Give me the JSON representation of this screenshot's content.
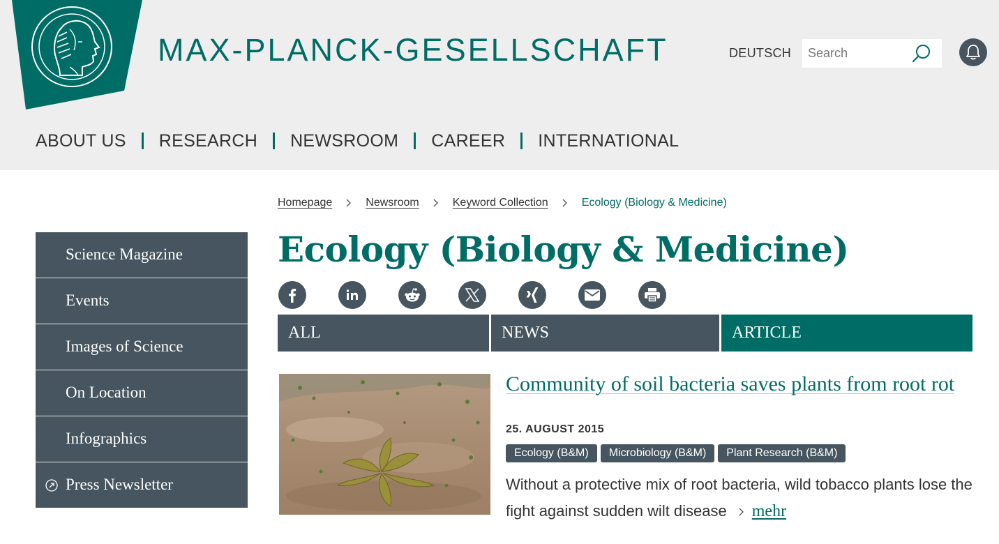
{
  "header": {
    "site_title": "MAX-PLANCK-GESELLSCHAFT",
    "language_link": "DEUTSCH",
    "search_placeholder": "Search"
  },
  "nav": {
    "items": [
      {
        "label": "ABOUT US"
      },
      {
        "label": "RESEARCH"
      },
      {
        "label": "NEWSROOM"
      },
      {
        "label": "CAREER"
      },
      {
        "label": "INTERNATIONAL"
      }
    ]
  },
  "breadcrumb": {
    "items": [
      "Homepage",
      "Newsroom",
      "Keyword Collection"
    ],
    "current": "Ecology (Biology & Medicine)"
  },
  "sidebar": {
    "items": [
      {
        "label": "Science Magazine"
      },
      {
        "label": "Events"
      },
      {
        "label": "Images of Science"
      },
      {
        "label": "On Location"
      },
      {
        "label": "Infographics"
      },
      {
        "label": "Press Newsletter",
        "icon": "external-link-icon"
      }
    ]
  },
  "page": {
    "title": "Ecology (Biology & Medicine)"
  },
  "share_icons": [
    "facebook-icon",
    "linkedin-icon",
    "reddit-icon",
    "x-icon",
    "xing-icon",
    "email-icon",
    "print-icon"
  ],
  "tabs": [
    {
      "label": "ALL",
      "active": false
    },
    {
      "label": "NEWS",
      "active": false
    },
    {
      "label": "ARTICLE",
      "active": true
    }
  ],
  "article": {
    "title": "Community of soil bacteria saves plants from root rot",
    "date": "25. AUGUST 2015",
    "tags": [
      "Ecology (B&M)",
      "Microbiology (B&M)",
      "Plant Research (B&M)"
    ],
    "teaser": "Without a protective mix of root bacteria, wild tobacco plants lose the fight against sudden wilt disease",
    "more_label": "mehr"
  },
  "colors": {
    "brand_green": "#006c66",
    "slate": "#46555f",
    "header_bg": "#eeeeee"
  }
}
